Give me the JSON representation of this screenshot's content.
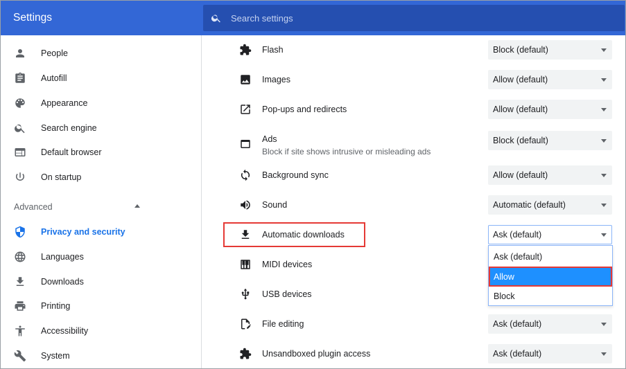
{
  "header": {
    "title": "Settings",
    "search_placeholder": "Search settings"
  },
  "sidebar": {
    "items": [
      {
        "label": "People",
        "icon": "person-icon"
      },
      {
        "label": "Autofill",
        "icon": "clipboard-icon"
      },
      {
        "label": "Appearance",
        "icon": "palette-icon"
      },
      {
        "label": "Search engine",
        "icon": "search-icon"
      },
      {
        "label": "Default browser",
        "icon": "browser-icon"
      },
      {
        "label": "On startup",
        "icon": "power-icon"
      }
    ],
    "advanced_label": "Advanced",
    "advanced_items": [
      {
        "label": "Privacy and security",
        "icon": "shield-icon",
        "active": true
      },
      {
        "label": "Languages",
        "icon": "globe-icon"
      },
      {
        "label": "Downloads",
        "icon": "download-icon"
      },
      {
        "label": "Printing",
        "icon": "printer-icon"
      },
      {
        "label": "Accessibility",
        "icon": "accessibility-icon"
      },
      {
        "label": "System",
        "icon": "wrench-icon"
      }
    ]
  },
  "permissions": [
    {
      "label": "Flash",
      "value": "Block (default)",
      "icon": "puzzle-icon"
    },
    {
      "label": "Images",
      "value": "Allow (default)",
      "icon": "image-icon"
    },
    {
      "label": "Pop-ups and redirects",
      "value": "Allow (default)",
      "icon": "open-in-new-icon"
    },
    {
      "label": "Ads",
      "sublabel": "Block if site shows intrusive or misleading ads",
      "value": "Block (default)",
      "icon": "ads-window-icon"
    },
    {
      "label": "Background sync",
      "value": "Allow (default)",
      "icon": "sync-icon"
    },
    {
      "label": "Sound",
      "value": "Automatic (default)",
      "icon": "volume-icon"
    },
    {
      "label": "Automatic downloads",
      "value": "Ask (default)",
      "icon": "download-icon"
    },
    {
      "label": "MIDI devices",
      "icon": "piano-icon"
    },
    {
      "label": "USB devices",
      "icon": "usb-icon"
    },
    {
      "label": "File editing",
      "value": "Ask (default)",
      "icon": "file-edit-icon"
    },
    {
      "label": "Unsandboxed plugin access",
      "value": "Ask (default)",
      "icon": "puzzle-icon"
    }
  ],
  "dropdown": {
    "options": [
      "Ask (default)",
      "Allow",
      "Block"
    ],
    "highlighted": "Allow"
  },
  "colors": {
    "header": "#3367d6",
    "search_bg": "#254fb0",
    "accent": "#1a73e8",
    "selected_option": "#1e90ff",
    "annotation": "#e53935"
  }
}
